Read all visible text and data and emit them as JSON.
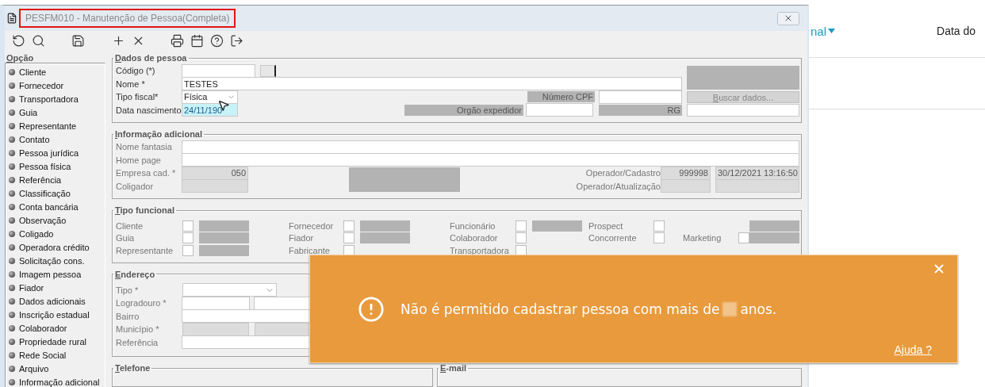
{
  "window": {
    "title": "PESFM010 - Manutenção de Pessoa(Completa)",
    "title_highlighted": true
  },
  "sidebar": {
    "heading": "Opção",
    "items": [
      "Cliente",
      "Fornecedor",
      "Transportadora",
      "Guia",
      "Representante",
      "Contato",
      "Pessoa jurídica",
      "Pessoa física",
      "Referência",
      "Classificação",
      "Conta bancária",
      "Observação",
      "Coligado",
      "Operadora crédito",
      "Solicitação cons.",
      "Imagem pessoa",
      "Fiador",
      "Dados adicionais",
      "Inscrição estadual",
      "Colaborador",
      "Propriedade rural",
      "Rede Social",
      "Arquivo",
      "Informação adicional"
    ]
  },
  "dados_de_pessoa": {
    "legend": "Dados de pessoa",
    "codigo": {
      "label": "Código (*)"
    },
    "nome": {
      "label": "Nome *",
      "value": "TESTES"
    },
    "tipo_fiscal": {
      "label": "Tipo fiscal*",
      "value": "Física"
    },
    "data_nascimento": {
      "label": "Data nascimento",
      "value": "24/11/190",
      "selected": true
    },
    "numero_cpf": {
      "label": "Número CPF"
    },
    "orgao_expedidor": {
      "label": "Orgão expedidor"
    },
    "rg": {
      "label": "RG"
    },
    "buscar_button": {
      "label": "Buscar dados...",
      "disabled": true
    }
  },
  "informacao_adicional": {
    "legend": "Informação adicional",
    "nome_fantasia": {
      "label": "Nome fantasia"
    },
    "home_page": {
      "label": "Home page"
    },
    "empresa_cad": {
      "label": "Empresa cad. *",
      "value": "050"
    },
    "coligador": {
      "label": "Coligador"
    },
    "operador_cadastro": {
      "label": "Operador/Cadastro",
      "value": "999998",
      "datetime": "30/12/2021 13:16:50"
    },
    "operador_atualizacao": {
      "label": "Operador/Atualização"
    }
  },
  "tipo_funcional": {
    "legend": "Tipo funcional",
    "rows": [
      [
        {
          "kind": "check_field",
          "label": "Cliente",
          "checked": false
        },
        {
          "kind": "check_field",
          "label": "Fornecedor",
          "checked": false
        },
        {
          "kind": "check_field",
          "label": "Funcionário",
          "checked": false
        },
        {
          "kind": "check",
          "label": "Prospect",
          "checked": false
        },
        {
          "kind": "field"
        }
      ],
      [
        {
          "kind": "check_field",
          "label": "Guia",
          "checked": false
        },
        {
          "kind": "check_field",
          "label": "Fiador",
          "checked": false
        },
        {
          "kind": "check",
          "label": "Colaborador",
          "checked": false
        },
        {
          "kind": "check",
          "label": "Concorrente",
          "checked": false
        },
        {
          "kind": "check_field",
          "label": "Marketing",
          "checked": false
        }
      ],
      [
        {
          "kind": "check_field",
          "label": "Representante",
          "checked": false
        },
        {
          "kind": "check",
          "label": "Fabricante",
          "checked": false
        },
        {
          "kind": "check",
          "label": "Transportadora",
          "checked": false
        }
      ]
    ]
  },
  "endereco": {
    "legend": "Endereço",
    "fields": [
      {
        "kind": "select",
        "label": "Tipo *"
      },
      {
        "kind": "pair",
        "label": "Logradouro *"
      },
      {
        "kind": "input",
        "label": "Bairro"
      },
      {
        "kind": "pair_disabled",
        "label": "Município *"
      },
      {
        "kind": "input",
        "label": "Referência"
      }
    ]
  },
  "telefone": {
    "legend": "Telefone"
  },
  "email": {
    "legend": "E-mail"
  },
  "background_page": {
    "link": "nal",
    "column": "Data do"
  },
  "alert": {
    "message_start": "Não é permitido cadastrar pessoa com mais de",
    "message_end": "anos.",
    "help_link": "Ajuda ?"
  }
}
